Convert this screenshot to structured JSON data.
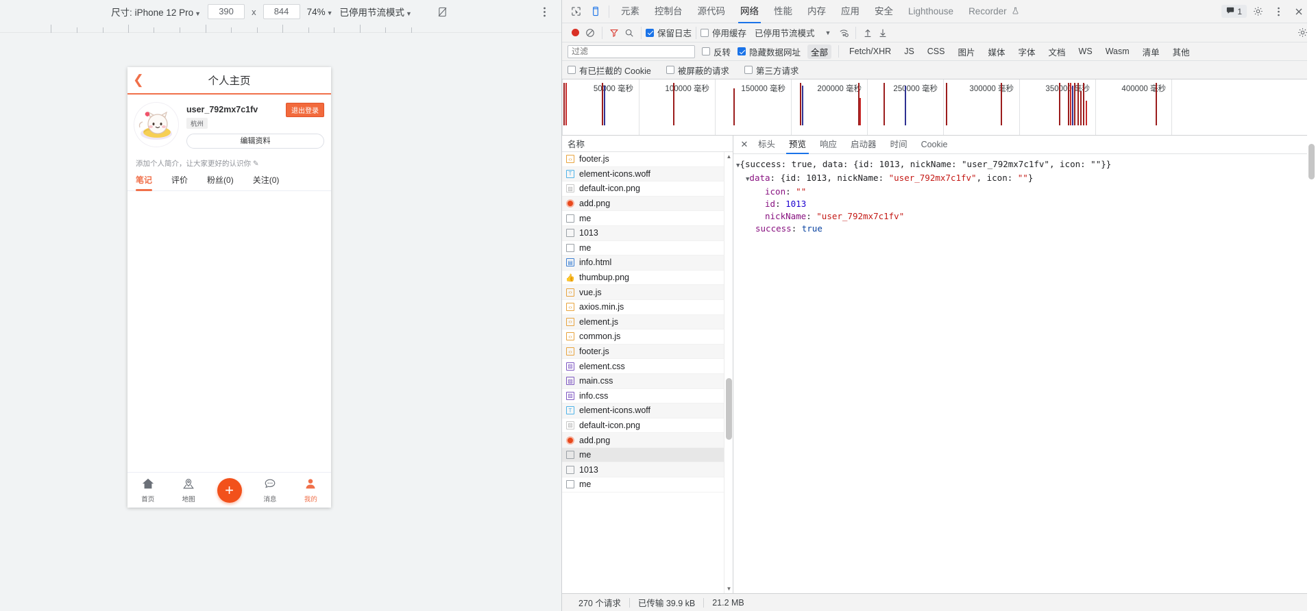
{
  "device_toolbar": {
    "size_label": "尺寸: iPhone 12 Pro",
    "width": "390",
    "times": "x",
    "height": "844",
    "zoom": "74%",
    "throttling": "已停用节流模式",
    "rotate_icon": "rotate-icon",
    "more_icon": "more-vertical-icon"
  },
  "phone": {
    "title": "个人主页",
    "back_icon": "chevron-left-icon",
    "nickname": "user_792mx7c1fv",
    "city": "杭州",
    "edit_profile": "编辑资料",
    "logout": "退出登录",
    "bio_hint": "添加个人简介，让大家更好的认识你 ✎",
    "tabs": [
      {
        "label": "笔记",
        "active": true
      },
      {
        "label": "评价",
        "active": false
      },
      {
        "label": "粉丝(0)",
        "active": false
      },
      {
        "label": "关注(0)",
        "active": false
      }
    ],
    "nav": [
      {
        "label": "首页",
        "icon": "home-icon",
        "active": false
      },
      {
        "label": "地图",
        "icon": "map-pin-icon",
        "active": false
      },
      {
        "label": "",
        "icon": "plus-icon",
        "active": false
      },
      {
        "label": "消息",
        "icon": "chat-bubble-icon",
        "active": false
      },
      {
        "label": "我的",
        "icon": "person-icon",
        "active": true
      }
    ]
  },
  "devtools": {
    "inspect_icon": "inspect-icon",
    "device_toggle_icon": "device-toolbar-icon",
    "panels": [
      {
        "label": "元素",
        "sel": false,
        "dim": false
      },
      {
        "label": "控制台",
        "sel": false,
        "dim": false
      },
      {
        "label": "源代码",
        "sel": false,
        "dim": false
      },
      {
        "label": "网络",
        "sel": true,
        "dim": false
      },
      {
        "label": "性能",
        "sel": false,
        "dim": false
      },
      {
        "label": "内存",
        "sel": false,
        "dim": false
      },
      {
        "label": "应用",
        "sel": false,
        "dim": false
      },
      {
        "label": "安全",
        "sel": false,
        "dim": false
      },
      {
        "label": "Lighthouse",
        "sel": false,
        "dim": true
      },
      {
        "label": "Recorder",
        "sel": false,
        "dim": true
      }
    ],
    "recorder_badge_icon": "flask-icon",
    "message_count": "1",
    "message_icon": "chat-icon",
    "settings_icon": "gear-icon",
    "kebab_icon": "more-vertical-icon",
    "close_icon": "close-icon",
    "network_toolbar": {
      "record_icon": "record-icon",
      "clear_icon": "clear-icon",
      "filter_icon": "filter-icon",
      "search_icon": "search-icon",
      "preserve_log": "保留日志",
      "preserve_log_checked": true,
      "disable_cache": "停用缓存",
      "disable_cache_checked": false,
      "throttling": "已停用节流模式",
      "wifi_icon": "wifi-settings-icon",
      "import_icon": "upload-icon",
      "export_icon": "download-icon",
      "settings_icon": "gear-icon"
    },
    "filter_row": {
      "placeholder": "过滤",
      "value": "",
      "invert": "反转",
      "invert_checked": false,
      "hide_data_urls": "隐藏数据网址",
      "hide_data_urls_checked": true,
      "types": [
        "全部",
        "Fetch/XHR",
        "JS",
        "CSS",
        "图片",
        "媒体",
        "字体",
        "文档",
        "WS",
        "Wasm",
        "清单",
        "其他"
      ],
      "active_type": "全部"
    },
    "options_row": {
      "blocked_cookies": "有已拦截的 Cookie",
      "blocked_cookies_checked": false,
      "blocked_requests": "被屏蔽的请求",
      "blocked_requests_checked": false,
      "third_party": "第三方请求",
      "third_party_checked": false
    },
    "overview": {
      "ticks": [
        "50000 毫秒",
        "100000 毫秒",
        "150000 毫秒",
        "200000 毫秒",
        "250000 毫秒",
        "300000 毫秒",
        "350000 毫秒",
        "400000 毫秒"
      ]
    },
    "list_header": "名称",
    "requests": [
      {
        "name": "footer.js",
        "icon": "js-file-icon",
        "type": "js"
      },
      {
        "name": "element-icons.woff",
        "icon": "font-file-icon",
        "type": "font"
      },
      {
        "name": "default-icon.png",
        "icon": "image-file-icon",
        "type": "img"
      },
      {
        "name": "add.png",
        "icon": "png-file-icon",
        "type": "png"
      },
      {
        "name": "me",
        "icon": "doc-file-icon",
        "type": "doc"
      },
      {
        "name": "1013",
        "icon": "doc-file-icon",
        "type": "doc"
      },
      {
        "name": "me",
        "icon": "doc-file-icon",
        "type": "doc"
      },
      {
        "name": "info.html",
        "icon": "html-file-icon",
        "type": "html"
      },
      {
        "name": "thumbup.png",
        "icon": "thumb-file-icon",
        "type": "thumb"
      },
      {
        "name": "vue.js",
        "icon": "js-file-icon",
        "type": "js"
      },
      {
        "name": "axios.min.js",
        "icon": "js-file-icon",
        "type": "js"
      },
      {
        "name": "element.js",
        "icon": "js-file-icon",
        "type": "js"
      },
      {
        "name": "common.js",
        "icon": "js-file-icon",
        "type": "js"
      },
      {
        "name": "footer.js",
        "icon": "js-file-icon",
        "type": "js"
      },
      {
        "name": "element.css",
        "icon": "css-file-icon",
        "type": "css"
      },
      {
        "name": "main.css",
        "icon": "css-file-icon",
        "type": "css"
      },
      {
        "name": "info.css",
        "icon": "css-file-icon",
        "type": "css"
      },
      {
        "name": "element-icons.woff",
        "icon": "font-file-icon",
        "type": "font"
      },
      {
        "name": "default-icon.png",
        "icon": "image-file-icon",
        "type": "img"
      },
      {
        "name": "add.png",
        "icon": "png-file-icon",
        "type": "png"
      },
      {
        "name": "me",
        "icon": "doc-file-icon",
        "type": "doc",
        "selected": true
      },
      {
        "name": "1013",
        "icon": "doc-file-icon",
        "type": "doc"
      },
      {
        "name": "me",
        "icon": "doc-file-icon",
        "type": "doc"
      }
    ],
    "detail_tabs": [
      {
        "label": "标头",
        "sel": false
      },
      {
        "label": "预览",
        "sel": true
      },
      {
        "label": "响应",
        "sel": false
      },
      {
        "label": "启动器",
        "sel": false
      },
      {
        "label": "时间",
        "sel": false
      },
      {
        "label": "Cookie",
        "sel": false
      }
    ],
    "preview_json": {
      "line1_prefix": "{success: ",
      "line1": "{success: true, data: {id: 1013, nickName: \"user_792mx7c1fv\", icon: \"\"}}",
      "line2": "data: {id: 1013, nickName: \"user_792mx7c1fv\", icon: \"\"}",
      "line3_key": "icon",
      "line3_val": "\"\"",
      "line4_key": "id",
      "line4_val": "1013",
      "line5_key": "nickName",
      "line5_val": "\"user_792mx7c1fv\"",
      "line6_key": "success",
      "line6_val": "true"
    },
    "status": {
      "requests": "270 个请求",
      "transferred": "已传输 39.9 kB",
      "resources": "21.2 MB"
    }
  }
}
